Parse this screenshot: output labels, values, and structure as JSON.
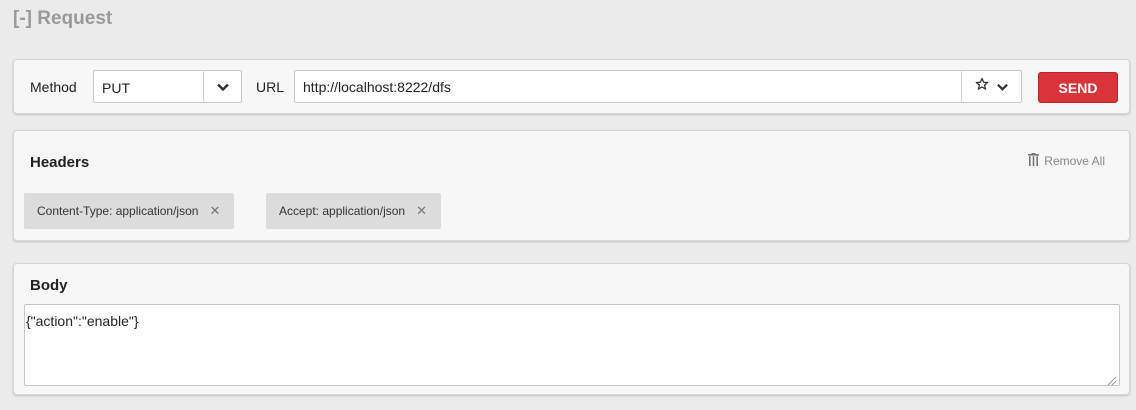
{
  "section": {
    "title": "[-] Request"
  },
  "request": {
    "method_label": "Method",
    "method_value": "PUT",
    "url_label": "URL",
    "url_value": "http://localhost:8222/dfs",
    "send_label": "SEND",
    "send_color": "#d9343a"
  },
  "headers": {
    "title": "Headers",
    "remove_all_label": "Remove All",
    "items": [
      {
        "label": "Content-Type: application/json"
      },
      {
        "label": "Accept: application/json"
      }
    ]
  },
  "body": {
    "title": "Body",
    "content": "{\"action\":\"enable\"}"
  },
  "icons": {
    "method_caret": "chevron-down-icon",
    "favorite": "star-icon",
    "url_caret": "chevron-down-icon",
    "remove_all": "trash-icon",
    "chip_remove": "close-icon",
    "textarea_resize": "resize-grip-icon"
  }
}
